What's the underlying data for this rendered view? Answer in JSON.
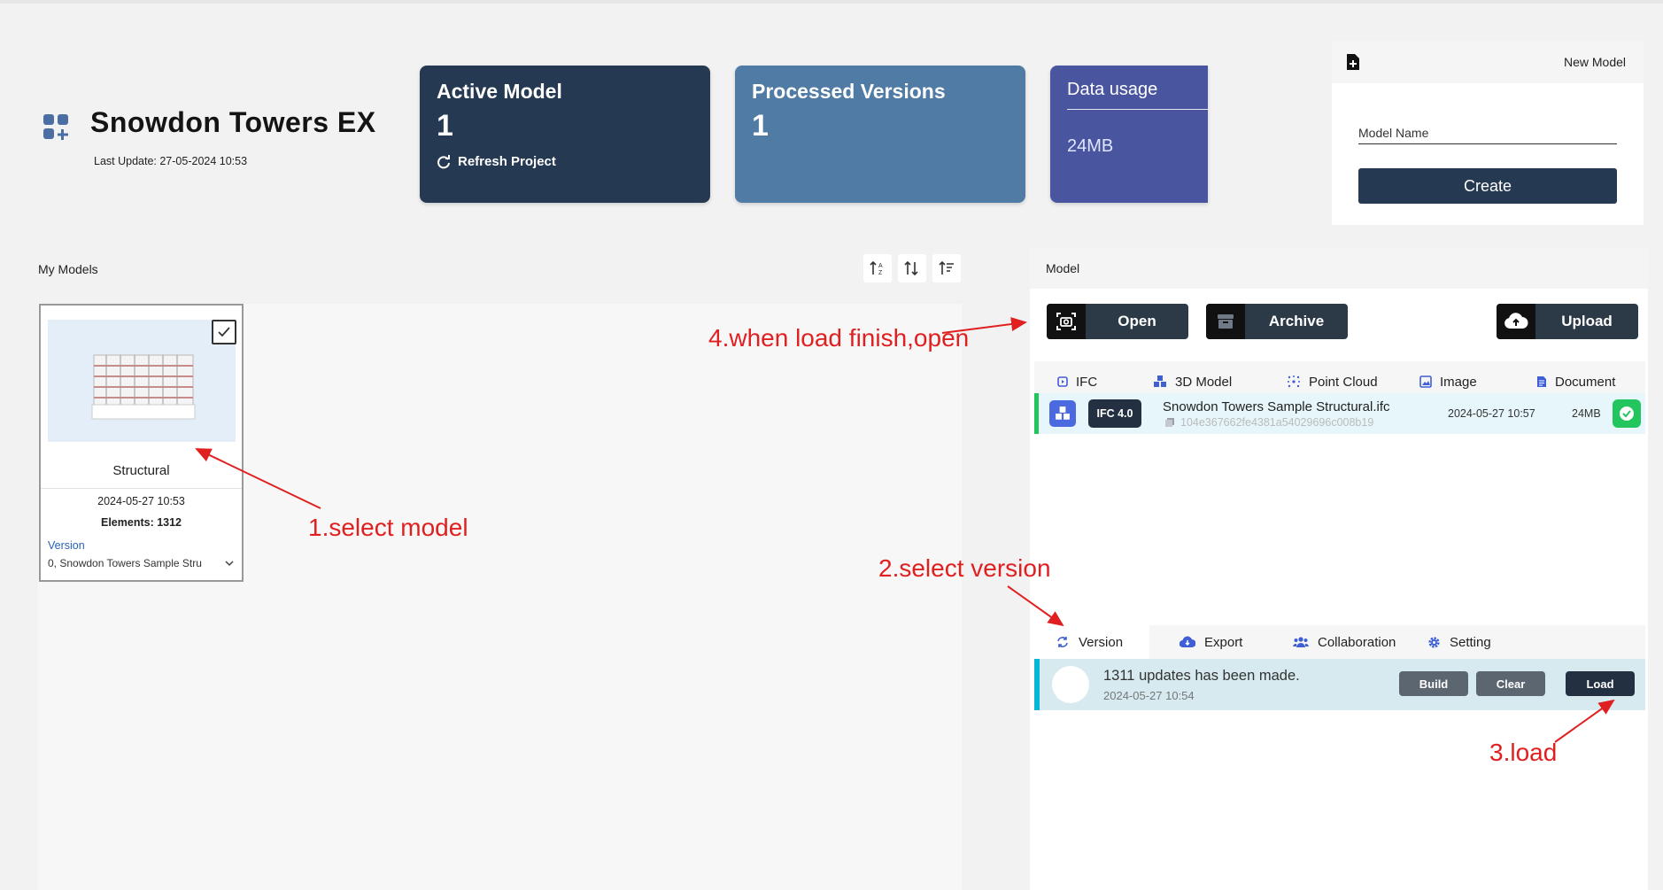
{
  "project": {
    "title": "Snowdon Towers EX",
    "last_update": "Last Update: 27-05-2024 10:53"
  },
  "cards": {
    "active_model": {
      "title": "Active Model",
      "value": "1",
      "action": "Refresh Project"
    },
    "processed_versions": {
      "title": "Processed Versions",
      "value": "1"
    },
    "data_usage": {
      "title": "Data usage",
      "value": "24MB"
    }
  },
  "new_model": {
    "title": "New Model",
    "field_label": "Model Name",
    "create_label": "Create"
  },
  "my_models": {
    "label": "My Models",
    "cards": [
      {
        "name": "Structural",
        "date": "2024-05-27 10:53",
        "elements": "Elements: 1312",
        "version_label": "Version",
        "version_value": "0, Snowdon Towers Sample Stru"
      }
    ]
  },
  "model_panel": {
    "title": "Model",
    "buttons": {
      "open": "Open",
      "archive": "Archive",
      "upload": "Upload"
    },
    "file_tabs": [
      "IFC",
      "3D Model",
      "Point Cloud",
      "Image",
      "Document"
    ],
    "file": {
      "tag": "IFC 4.0",
      "name": "Snowdon Towers Sample Structural.ifc",
      "hash": "104e367662fe4381a54029696c008b19",
      "date": "2024-05-27 10:57",
      "size": "24MB"
    },
    "version_tabs": [
      "Version",
      "Export",
      "Collaboration",
      "Setting"
    ],
    "version_row": {
      "message": "1311 updates has been made.",
      "date": "2024-05-27 10:54",
      "build": "Build",
      "clear": "Clear",
      "load": "Load"
    }
  },
  "annotations": {
    "a1": "1.select model",
    "a2": "2.select version",
    "a3": "3.load",
    "a4": "4.when load finish,open"
  },
  "colors": {
    "navy": "#253a52",
    "steel_blue": "#4f7ba4",
    "indigo": "#4a55a0",
    "success": "#22c55e",
    "annotation": "#e02020"
  }
}
